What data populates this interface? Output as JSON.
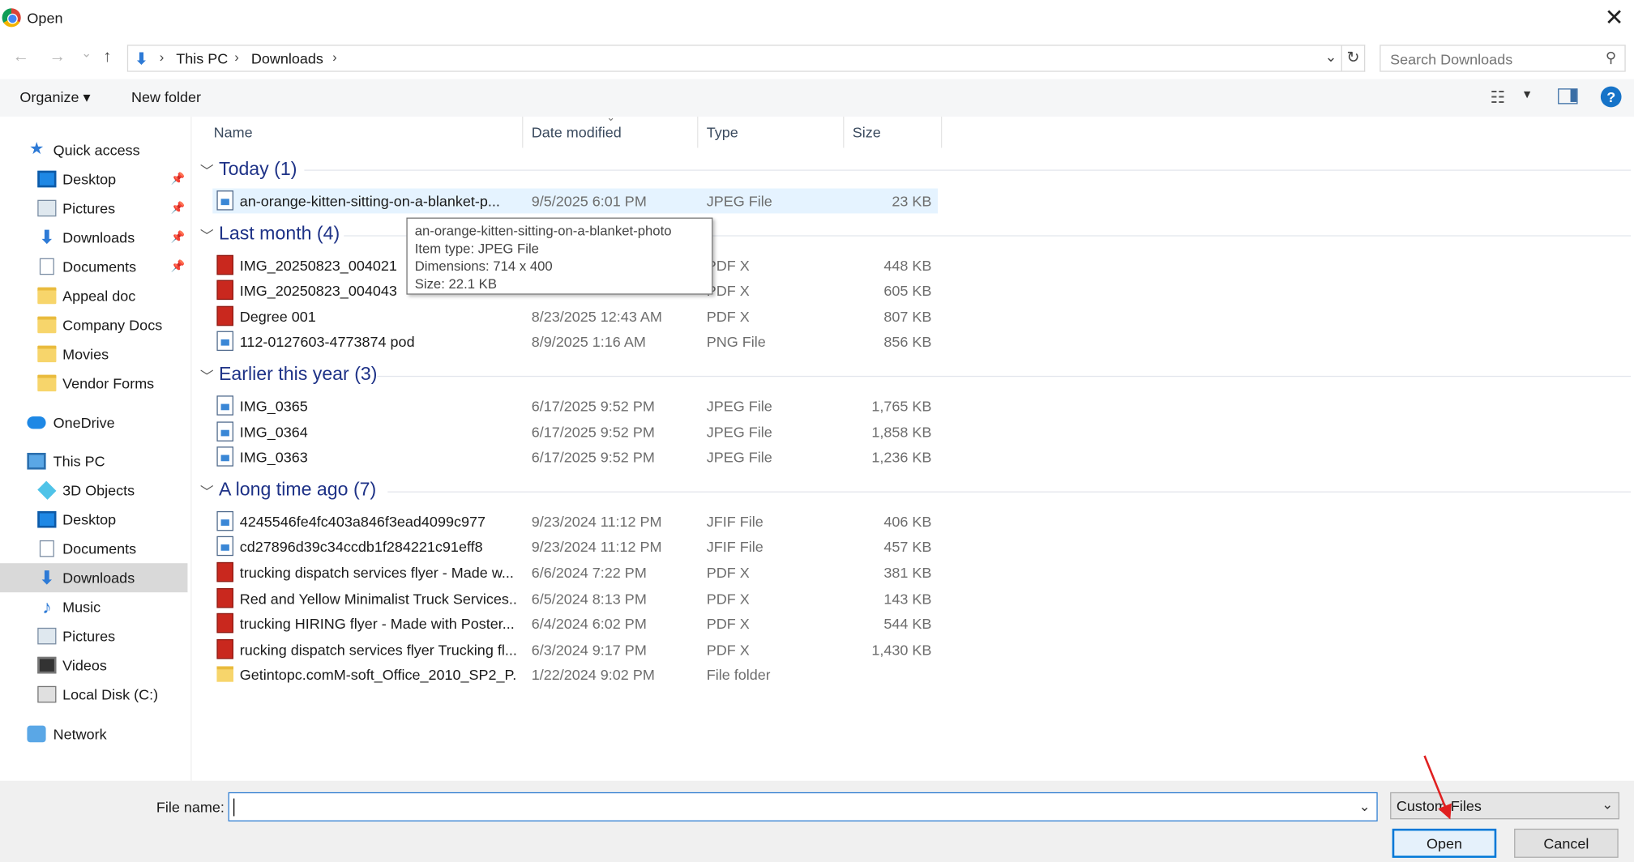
{
  "window": {
    "title": "Open",
    "close_label": "✕"
  },
  "nav": {
    "back_label": "←",
    "forward_label": "→",
    "recent_label": "⌄",
    "up_label": "↑",
    "path": [
      "This PC",
      "Downloads"
    ],
    "separator": "›",
    "refresh_label": "↻",
    "search_placeholder": "Search Downloads"
  },
  "toolbar": {
    "organize_label": "Organize ▾",
    "new_folder_label": "New folder",
    "help_label": "?"
  },
  "sidebar": {
    "quick_access": "Quick access",
    "quick_items": [
      "Desktop",
      "Pictures",
      "Downloads",
      "Documents",
      "Appeal doc",
      "Company Docs",
      "Movies",
      "Vendor Forms"
    ],
    "onedrive": "OneDrive",
    "this_pc": "This PC",
    "pc_items": [
      "3D Objects",
      "Desktop",
      "Documents",
      "Downloads",
      "Music",
      "Pictures",
      "Videos",
      "Local Disk (C:)"
    ],
    "network": "Network",
    "selected": "Downloads"
  },
  "columns": {
    "name": "Name",
    "date": "Date modified",
    "type": "Type",
    "size": "Size"
  },
  "groups": [
    {
      "label": "Today (1)",
      "files": [
        {
          "name": "an-orange-kitten-sitting-on-a-blanket-p...",
          "date": "9/5/2025 6:01 PM",
          "type": "JPEG File",
          "size": "23 KB",
          "icon": "image"
        }
      ]
    },
    {
      "label": "Last month (4)",
      "files": [
        {
          "name": "IMG_20250823_004021",
          "date": "",
          "type": "PDF X",
          "size": "448 KB",
          "icon": "pdf"
        },
        {
          "name": "IMG_20250823_004043",
          "date": "",
          "type": "PDF X",
          "size": "605 KB",
          "icon": "pdf"
        },
        {
          "name": "Degree 001",
          "date": "8/23/2025 12:43 AM",
          "type": "PDF X",
          "size": "807 KB",
          "icon": "pdf"
        },
        {
          "name": "112-0127603-4773874 pod",
          "date": "8/9/2025 1:16 AM",
          "type": "PNG File",
          "size": "856 KB",
          "icon": "image"
        }
      ]
    },
    {
      "label": "Earlier this year (3)",
      "files": [
        {
          "name": "IMG_0365",
          "date": "6/17/2025 9:52 PM",
          "type": "JPEG File",
          "size": "1,765 KB",
          "icon": "image"
        },
        {
          "name": "IMG_0364",
          "date": "6/17/2025 9:52 PM",
          "type": "JPEG File",
          "size": "1,858 KB",
          "icon": "image"
        },
        {
          "name": "IMG_0363",
          "date": "6/17/2025 9:52 PM",
          "type": "JPEG File",
          "size": "1,236 KB",
          "icon": "image"
        }
      ]
    },
    {
      "label": "A long time ago (7)",
      "files": [
        {
          "name": "4245546fe4fc403a846f3ead4099c977",
          "date": "9/23/2024 11:12 PM",
          "type": "JFIF File",
          "size": "406 KB",
          "icon": "image"
        },
        {
          "name": "cd27896d39c34ccdb1f284221c91eff8",
          "date": "9/23/2024 11:12 PM",
          "type": "JFIF File",
          "size": "457 KB",
          "icon": "image"
        },
        {
          "name": "trucking dispatch services flyer - Made w...",
          "date": "6/6/2024 7:22 PM",
          "type": "PDF X",
          "size": "381 KB",
          "icon": "pdf"
        },
        {
          "name": "Red and Yellow Minimalist Truck Services...",
          "date": "6/5/2024 8:13 PM",
          "type": "PDF X",
          "size": "143 KB",
          "icon": "pdf"
        },
        {
          "name": "trucking HIRING flyer - Made with Poster...",
          "date": "6/4/2024 6:02 PM",
          "type": "PDF X",
          "size": "544 KB",
          "icon": "pdf"
        },
        {
          "name": "rucking dispatch services flyer Trucking fl...",
          "date": "6/3/2024 9:17 PM",
          "type": "PDF X",
          "size": "1,430 KB",
          "icon": "pdf"
        },
        {
          "name": "Getintopc.comM-soft_Office_2010_SP2_P...",
          "date": "1/22/2024 9:02 PM",
          "type": "File folder",
          "size": "",
          "icon": "folder"
        }
      ]
    }
  ],
  "tooltip": {
    "line1": "an-orange-kitten-sitting-on-a-blanket-photo",
    "line2": "Item type: JPEG File",
    "line3": "Dimensions: 714 x 400",
    "line4": "Size: 22.1 KB"
  },
  "footer": {
    "file_name_label": "File name:",
    "file_name_value": "",
    "filter_value": "Custom Files",
    "open_label": "Open",
    "cancel_label": "Cancel"
  },
  "colors": {
    "accent": "#0078d7",
    "group_header": "#1e3287",
    "annotation_arrow": "#e02020"
  }
}
